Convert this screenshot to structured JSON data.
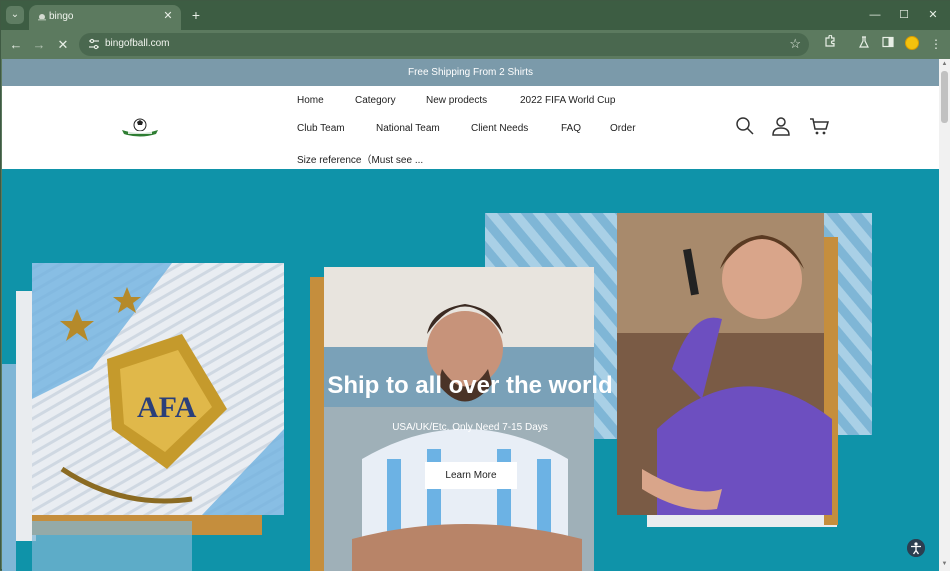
{
  "browser": {
    "tab_title": "bingo",
    "url": "bingofball.com",
    "tab_close": "✕",
    "new_tab": "+",
    "minimize": "—",
    "maximize": "☐",
    "close": "✕",
    "back": "←",
    "forward": "→",
    "stop": "✕",
    "menu": "⋮"
  },
  "site": {
    "announcement": "Free Shipping From 2 Shirts",
    "nav": {
      "home": "Home",
      "category": "Category",
      "new_products": "New prodects",
      "world_cup": "2022 FIFA World Cup",
      "club_team": "Club Team",
      "national_team": "National Team",
      "client_needs": "Client Needs",
      "faq": "FAQ",
      "order": "Order",
      "size_reference": "Size reference（Must see ..."
    },
    "hero": {
      "title": "Ship to all over the world",
      "subtitle": "USA/UK/Etc. Only Need 7-15 Days",
      "button": "Learn More"
    }
  },
  "colors": {
    "announcement_bg": "#7b9aaa",
    "hero_bg": "#0f93a9",
    "browser_frame": "#5c7a5f"
  },
  "icons": [
    "search-icon",
    "user-icon",
    "cart-icon",
    "star-icon",
    "extensions-icon",
    "labs-icon",
    "sidebar-icon",
    "profile-avatar",
    "accessibility-icon"
  ]
}
